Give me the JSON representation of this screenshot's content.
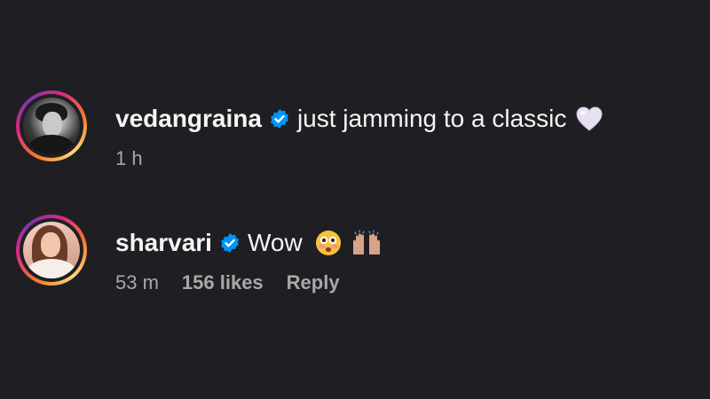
{
  "comments": [
    {
      "username": "vedangraina",
      "verified": true,
      "text": "just jamming to a classic",
      "emoji": "white-heart-emoji",
      "time": "1 h"
    },
    {
      "username": "sharvari",
      "verified": true,
      "text": "Wow",
      "emojis": [
        "flushed-face-emoji",
        "raising-hands-emoji"
      ],
      "time": "53 m",
      "likes": "156 likes",
      "reply_label": "Reply"
    }
  ],
  "colors": {
    "background": "#1f1f23",
    "text": "#f5f5f5",
    "meta_text": "#a8a8a8",
    "verified_blue": "#0095f6"
  }
}
